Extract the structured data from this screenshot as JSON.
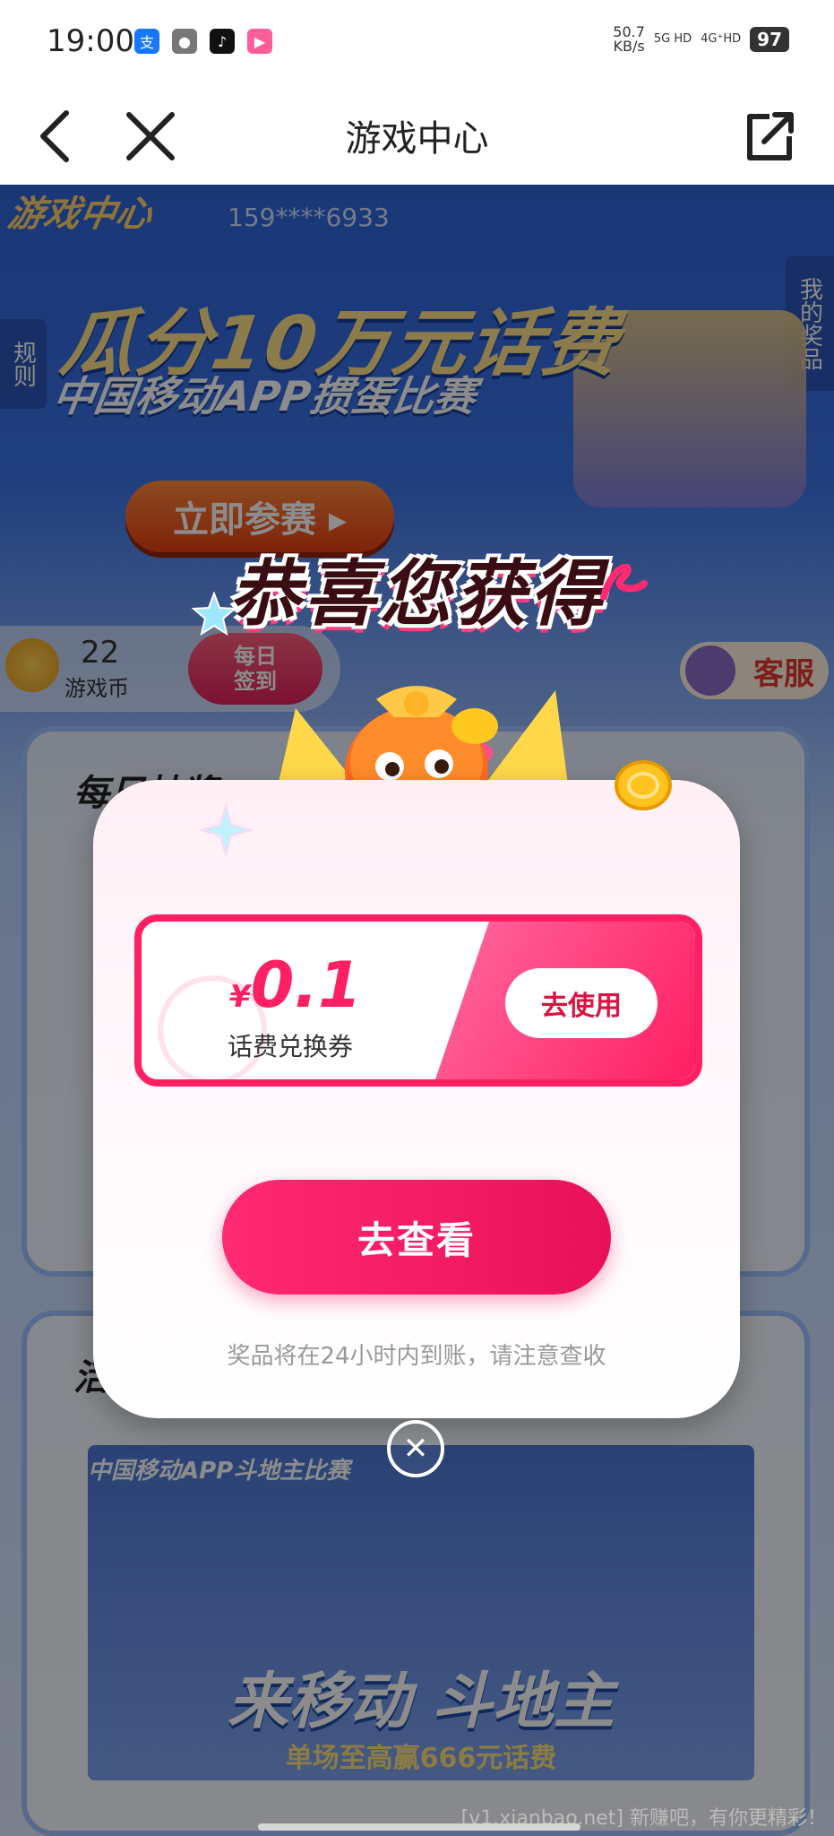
{
  "status_bar": {
    "time": "19:00",
    "apps": [
      {
        "icon": "alipay-icon",
        "glyph": "支",
        "color": "#1677ff"
      },
      {
        "icon": "message-icon",
        "glyph": "●",
        "color": "#777777"
      },
      {
        "icon": "tiktok-icon",
        "glyph": "♪",
        "color": "#111111"
      },
      {
        "icon": "bilibili-icon",
        "glyph": "▶",
        "color": "#ff5c9a"
      }
    ],
    "speed_value": "50.7",
    "speed_unit": "KB/s",
    "network_1": "5G HD",
    "network_2": "4G⁺HD",
    "battery": "97"
  },
  "nav": {
    "title": "游戏中心"
  },
  "background": {
    "logo": "游戏中心",
    "phone_masked": "159****6933",
    "rules_label": "规则",
    "my_prizes_label": "我的奖品",
    "banner_headline": "瓜分10万元话费",
    "banner_subtitle": "中国移动APP掼蛋比赛",
    "join_button": "立即参赛 ▸",
    "coin_count": "22",
    "coin_label": "游戏币",
    "checkin_label": "每日\n签到",
    "service_label": "客服",
    "card1_title": "每日抽奖",
    "card2_title": "活动",
    "duel_tag": "中国移动APP斗地主比赛",
    "duel_title": "来移动 斗地主",
    "duel_subtitle": "单场至高赢666元话费"
  },
  "modal": {
    "headline": "恭喜您获得",
    "currency_symbol": "¥",
    "amount": "0.1",
    "voucher_name": "话费兑换券",
    "use_button": "去使用",
    "view_button": "去查看",
    "notice": "奖品将在24小时内到账，请注意查收",
    "close_glyph": "✕"
  },
  "watermark": "[v1.xianbao.net] 新赚吧，有你更精彩！",
  "colors": {
    "accent": "#ff1f63",
    "overlay": "rgba(0,0,0,0.45)"
  }
}
